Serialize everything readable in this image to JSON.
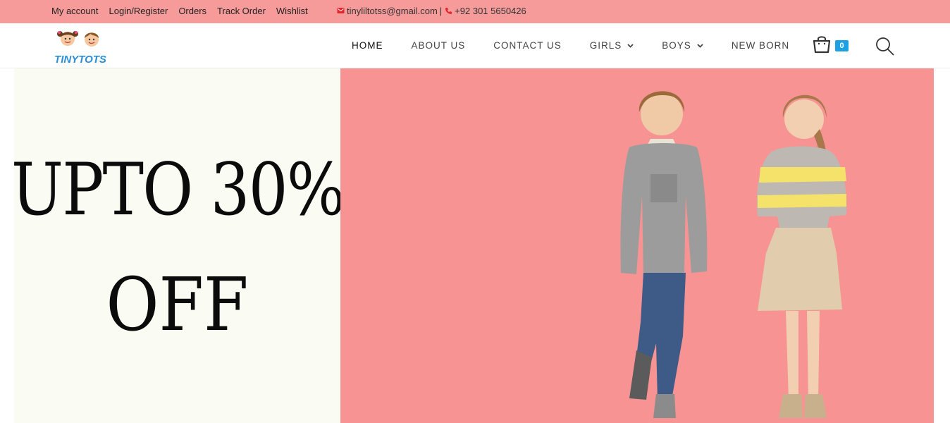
{
  "topbar": {
    "links": [
      "My account",
      "Login/Register",
      "Orders",
      "Track Order",
      "Wishlist"
    ],
    "email": "tinyliltotss@gmail.com",
    "separator": "|",
    "phone": "+92 301 5650426"
  },
  "header": {
    "logo_text": "TINYTOTS",
    "nav": {
      "home": "HOME",
      "about": "ABOUT US",
      "contact": "CONTACT US",
      "girls": "GIRLS",
      "boys": "BOYS",
      "newborn": "NEW BORN"
    },
    "cart_count": "0"
  },
  "hero": {
    "line1": "UPTO 30%",
    "line2": "OFF"
  },
  "colors": {
    "topbar_bg": "#f79a9a",
    "hero_right_bg": "#f79393",
    "hero_left_bg": "#fafbf3",
    "cart_badge": "#1ea1e3",
    "icon_red": "#e3282d"
  }
}
